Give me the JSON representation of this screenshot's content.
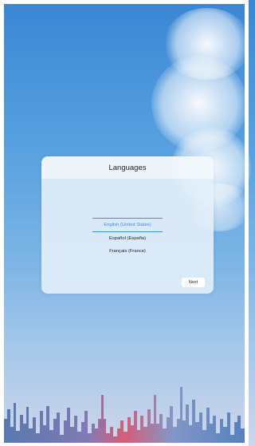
{
  "dialog": {
    "title": "Languages",
    "languages": [
      {
        "label": "English (United States)",
        "selected": true
      },
      {
        "label": "Español (España)",
        "selected": false
      },
      {
        "label": "Français (France)",
        "selected": false
      }
    ],
    "next_label": "Next"
  },
  "colors": {
    "accent": "#3b8de0",
    "sky_top": "#3a86d4",
    "sky_bottom": "#cfd6ea"
  }
}
